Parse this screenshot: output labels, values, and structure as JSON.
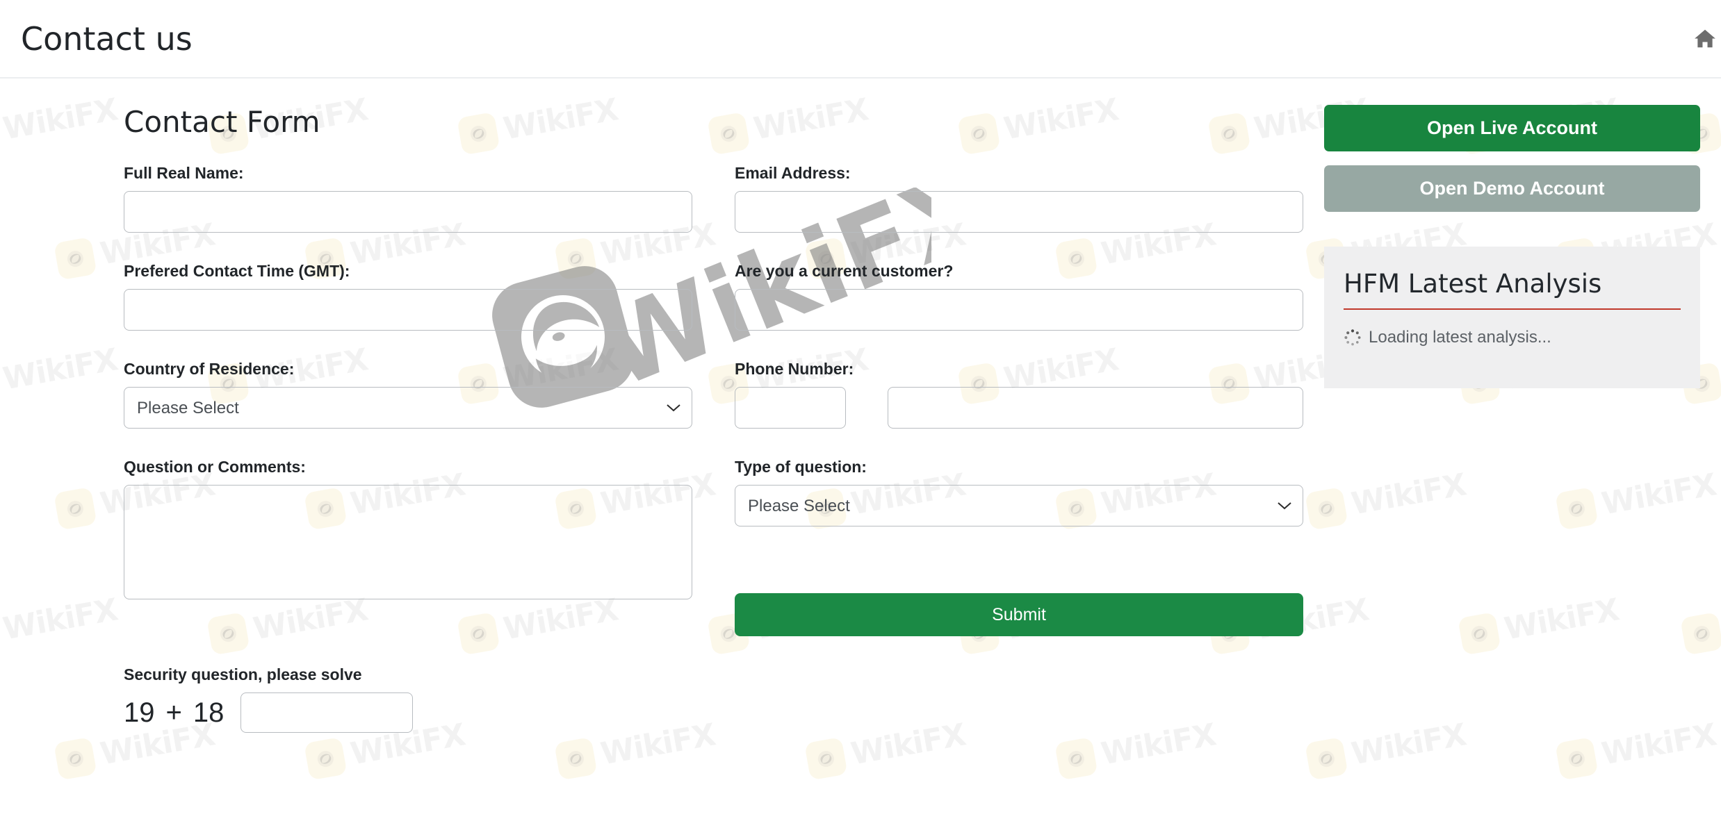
{
  "header": {
    "title": "Contact us",
    "breadcrumb": {
      "home_icon": "home-icon",
      "separator": "/"
    }
  },
  "form": {
    "heading": "Contact Form",
    "fields": {
      "full_name": {
        "label": "Full Real Name:",
        "value": "",
        "placeholder": ""
      },
      "email": {
        "label": "Email Address:",
        "value": "",
        "placeholder": ""
      },
      "contact_time": {
        "label": "Prefered Contact Time (GMT):",
        "value": "",
        "placeholder": ""
      },
      "current_customer": {
        "label": "Are you a current customer?",
        "value": "",
        "placeholder": ""
      },
      "country": {
        "label": "Country of Residence:",
        "selected": "Please Select",
        "options": [
          "Please Select"
        ]
      },
      "phone": {
        "label": "Phone Number:",
        "code_value": "",
        "number_value": ""
      },
      "comments": {
        "label": "Question or Comments:",
        "value": "",
        "placeholder": ""
      },
      "question_type": {
        "label": "Type of question:",
        "selected": "Please Select",
        "options": [
          "Please Select"
        ]
      },
      "security": {
        "label": "Security question, please solve",
        "operand_a": "19",
        "operator": "+",
        "operand_b": "18",
        "answer": ""
      }
    },
    "submit_label": "Submit"
  },
  "sidebar": {
    "live_account_label": "Open Live Account",
    "demo_account_label": "Open Demo Account",
    "analysis": {
      "title": "HFM Latest Analysis",
      "loading_text": "Loading latest analysis...",
      "spinner_icon": "loading-spinner-icon"
    }
  },
  "watermark": {
    "word": "WikiFX",
    "big_word": "WikiFX"
  },
  "colors": {
    "green_primary": "#18853f",
    "green_submit": "#1b8a45",
    "demo_grey": "#97a8a3",
    "accent_red": "#c0392b",
    "border": "#b8bcc0",
    "panel_bg": "#efeff0"
  }
}
